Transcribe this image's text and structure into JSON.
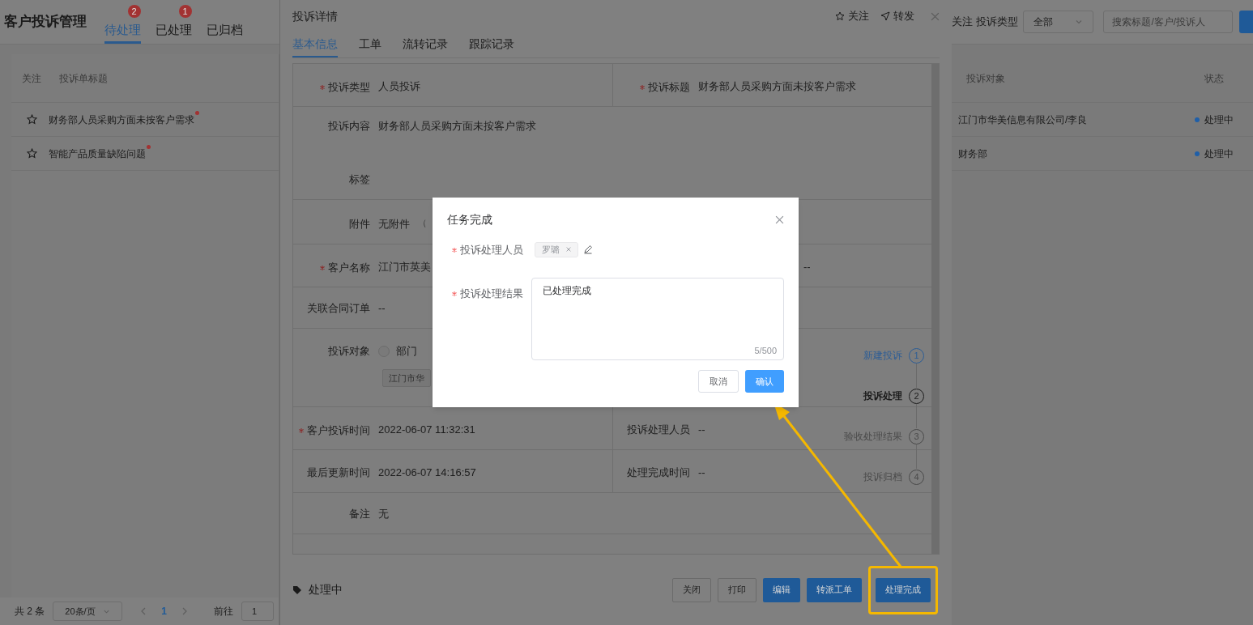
{
  "page": {
    "title": "客户投诉管理",
    "tabs": [
      {
        "label": "待处理",
        "badge": "2",
        "selected": true
      },
      {
        "label": "已处理",
        "badge": "1",
        "selected": false
      },
      {
        "label": "已归档",
        "selected": false
      }
    ],
    "filters": {
      "follow_label": "关注",
      "type_label": "投诉类型",
      "type_value": "全部",
      "search_placeholder": "搜索标题/客户/投诉人"
    },
    "table": {
      "columns": [
        "关注",
        "投诉单标题",
        "投诉对象",
        "状态"
      ],
      "rows": [
        {
          "followed": false,
          "title": "财务部人员采购方面未按客户需求",
          "unread": true,
          "target": "江门市华美信息有限公司/李良",
          "status": "处理中",
          "color": "#1f5fa8"
        },
        {
          "followed": false,
          "title": "智能产品质量缺陷问题",
          "unread": true,
          "target": "财务部",
          "status": "处理中",
          "color": "#1f5fa8"
        }
      ]
    },
    "pagination": {
      "total": "共 2 条",
      "page_size": "20条/页",
      "pages": [
        {
          "label": "1",
          "selected": true
        }
      ],
      "goto_label": "前往",
      "goto_value": "1"
    }
  },
  "drawer": {
    "title": "投诉详情",
    "actions": [
      {
        "kind": "follow",
        "label": "关注"
      },
      {
        "kind": "forward",
        "label": "转发"
      }
    ],
    "tabs": [
      {
        "label": "基本信息",
        "selected": true
      },
      {
        "label": "工单",
        "selected": false
      },
      {
        "label": "流转记录",
        "selected": false
      },
      {
        "label": "跟踪记录",
        "selected": false
      }
    ],
    "rows": [
      {
        "kind": "pair",
        "cells": [
          {
            "label": "投诉类型",
            "value": "人员投诉",
            "required": true
          },
          {
            "label": "投诉标题",
            "value": "财务部人员采购方面未按客户需求",
            "required": true
          }
        ]
      },
      {
        "kind": "textarea",
        "cells": [
          {
            "label": "投诉内容",
            "value": "财务部人员采购方面未按客户需求",
            "required": false
          }
        ]
      },
      {
        "kind": "single",
        "cells": [
          {
            "label": "标签",
            "required": false
          }
        ]
      },
      {
        "kind": "attachment",
        "cells": [
          {
            "label": "附件",
            "value": "无附件",
            "hint": "（",
            "required": false
          }
        ]
      },
      {
        "kind": "pair",
        "cells": [
          {
            "label": "客户名称",
            "value": "江门市英美",
            "required": true
          },
          {
            "value": "--"
          }
        ]
      },
      {
        "kind": "single",
        "cells": [
          {
            "label": "关联合同订单",
            "value": "--",
            "required": false
          }
        ]
      },
      {
        "kind": "target",
        "cells": [
          {
            "label": "投诉对象",
            "option": {
              "label": "部门",
              "selected": false
            },
            "tag": "江门市华",
            "required": false
          }
        ]
      },
      {
        "kind": "pair",
        "cells": [
          {
            "label": "客户投诉时间",
            "value": "2022-06-07 11:32:31",
            "required": true
          },
          {
            "label": "投诉处理人员",
            "value": "--",
            "required": false
          }
        ]
      },
      {
        "kind": "pair",
        "cells": [
          {
            "label": "最后更新时间",
            "value": "2022-06-07 14:16:57",
            "required": false
          },
          {
            "label": "处理完成时间",
            "value": "--",
            "required": false
          }
        ]
      },
      {
        "kind": "single",
        "cells": [
          {
            "label": "备注",
            "value": "无",
            "required": false
          }
        ]
      }
    ],
    "steps": [
      {
        "label": "新建投诉",
        "number": "1",
        "finished": true,
        "active": false
      },
      {
        "label": "投诉处理",
        "number": "2",
        "finished": false,
        "active": true
      },
      {
        "label": "验收处理结果",
        "number": "3",
        "finished": false,
        "active": false
      },
      {
        "label": "投诉归档",
        "number": "4",
        "finished": false,
        "active": false
      }
    ],
    "status_label": "处理中",
    "buttons": [
      {
        "label": "关闭",
        "primary": false,
        "highlighted": false
      },
      {
        "label": "打印",
        "primary": false,
        "highlighted": false
      },
      {
        "label": "编辑",
        "primary": true,
        "highlighted": false
      },
      {
        "label": "转派工单",
        "primary": true,
        "highlighted": false
      },
      {
        "label": "处理完成",
        "primary": true,
        "highlighted": true
      }
    ]
  },
  "dialog": {
    "title": "任务完成",
    "handler": {
      "label": "投诉处理人员",
      "required": true,
      "tags": [
        "罗璐"
      ]
    },
    "result": {
      "label": "投诉处理结果",
      "required": true,
      "value": "已处理完成",
      "count": "5/500"
    },
    "buttons": [
      {
        "label": "取消",
        "primary": false
      },
      {
        "label": "确认",
        "primary": true
      }
    ]
  }
}
